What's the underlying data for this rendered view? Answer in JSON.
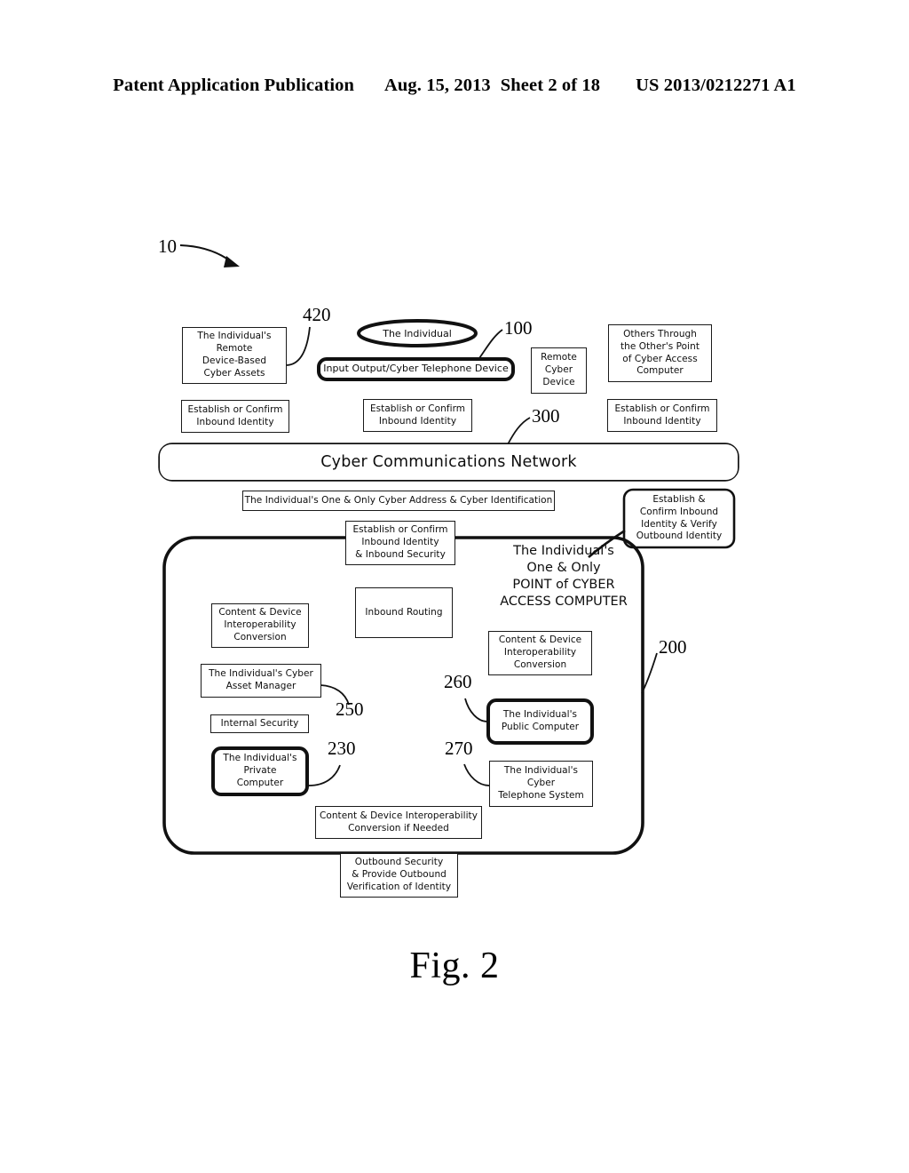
{
  "header": {
    "publication": "Patent Application Publication",
    "date": "Aug. 15, 2013",
    "sheet": "Sheet 2 of 18",
    "patent_number": "US 2013/0212271 A1"
  },
  "figure": {
    "caption": "Fig. 2",
    "system_ref": "10"
  },
  "refs": {
    "r10": "10",
    "r420": "420",
    "r100": "100",
    "r300": "300",
    "r200": "200",
    "r250": "250",
    "r230": "230",
    "r260": "260",
    "r270": "270"
  },
  "top_row": {
    "remote_assets": {
      "lines": [
        "The Individual's",
        "Remote",
        "Device-Based",
        "Cyber Assets"
      ]
    },
    "individual_ellipse": {
      "label": "The Individual"
    },
    "io_device": {
      "label": "Input Output/Cyber Telephone Device"
    },
    "remote_cyber_device": {
      "lines": [
        "Remote",
        "Cyber",
        "Device"
      ]
    },
    "others_access": {
      "lines": [
        "Others Through",
        "the Other's Point",
        "of Cyber Access",
        "Computer"
      ]
    },
    "establish_left": {
      "lines": [
        "Establish or Confirm",
        "Inbound Identity"
      ]
    },
    "establish_center": {
      "lines": [
        "Establish or Confirm",
        "Inbound Identity"
      ]
    },
    "establish_right": {
      "lines": [
        "Establish or Confirm",
        "Inbound Identity"
      ]
    }
  },
  "network": {
    "label": "Cyber Communications Network"
  },
  "address_bar": {
    "label": "The Individual's One & Only Cyber Address & Cyber Identification"
  },
  "verify_box": {
    "lines": [
      "Establish &",
      "Confirm Inbound",
      "Identity & Verify",
      "Outbound Identity"
    ]
  },
  "pcac": {
    "title_lines": [
      "The Individual's",
      "One & Only",
      "POINT of CYBER",
      "ACCESS  COMPUTER"
    ],
    "inbound_identity": {
      "lines": [
        "Establish or Confirm",
        "Inbound Identity",
        "& Inbound Security"
      ]
    },
    "inbound_routing": {
      "label": "Inbound Routing"
    },
    "left_conversion": {
      "lines": [
        "Content & Device",
        "Interoperability",
        "Conversion"
      ]
    },
    "asset_manager": {
      "lines": [
        "The Individual's Cyber",
        "Asset Manager"
      ]
    },
    "internal_security": {
      "label": "Internal Security"
    },
    "private_computer": {
      "lines": [
        "The Individual's",
        "Private",
        "Computer"
      ]
    },
    "right_conversion": {
      "lines": [
        "Content & Device",
        "Interoperability",
        "Conversion"
      ]
    },
    "public_computer": {
      "lines": [
        "The Individual's",
        "Public Computer"
      ]
    },
    "cyber_telephone_system": {
      "lines": [
        "The Individual's",
        "Cyber",
        "Telephone System"
      ]
    },
    "conversion_if_needed": {
      "lines": [
        "Content & Device Interoperability",
        "Conversion if Needed"
      ]
    },
    "outbound_security": {
      "lines": [
        "Outbound Security",
        "& Provide Outbound",
        "Verification of Identity"
      ]
    }
  },
  "colors": {
    "ink": "#111111",
    "paper": "#ffffff"
  }
}
